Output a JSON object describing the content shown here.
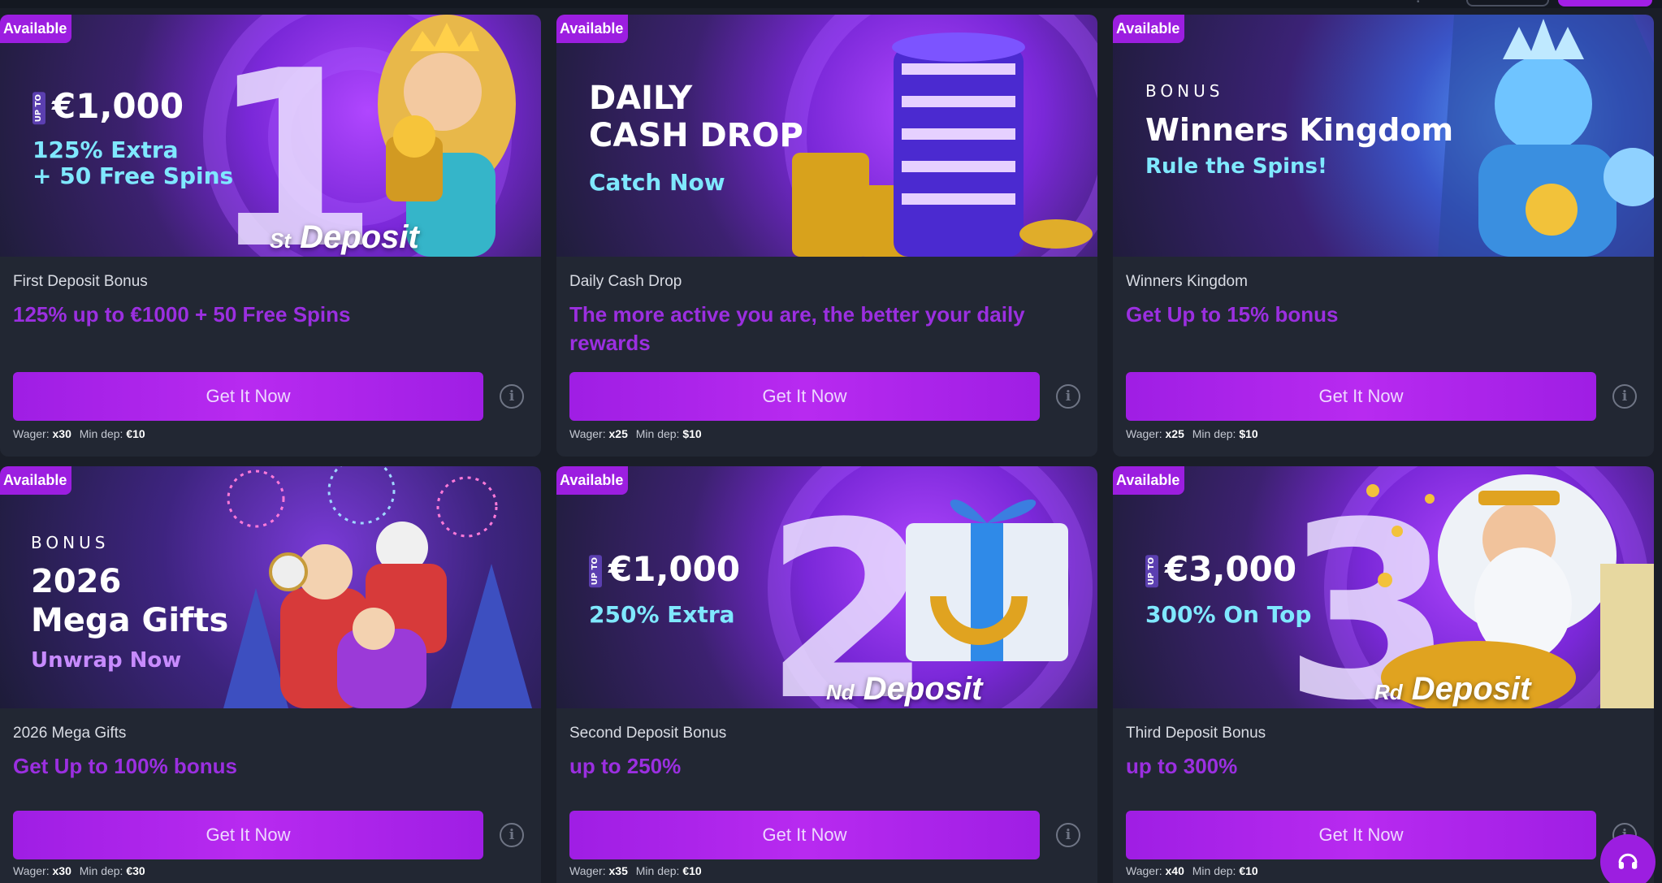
{
  "badge_label": "Available",
  "cta_label": "Get It Now",
  "wager_label": "Wager:",
  "mindep_label": "Min dep:",
  "cards": [
    {
      "title": "First Deposit Bonus",
      "subtitle": "125% up to €1000 + 50 Free Spins",
      "wager": "x30",
      "min_dep": "€10",
      "banner": {
        "upto": "UP TO",
        "amount": "€1,000",
        "line1": "125% Extra",
        "line2": "+ 50 Free Spins",
        "big_num": "1",
        "suffix": "St",
        "deposit_word": "Deposit"
      }
    },
    {
      "title": "Daily Cash Drop",
      "subtitle": "The more active you are, the better your daily rewards",
      "wager": "x25",
      "min_dep": "$10",
      "banner": {
        "line1": "DAILY",
        "line2": "CASH DROP",
        "accent": "Catch Now"
      }
    },
    {
      "title": "Winners Kingdom",
      "subtitle": "Get Up to 15% bonus",
      "wager": "x25",
      "min_dep": "$10",
      "banner": {
        "bonus": "BONUS",
        "headline": "Winners Kingdom",
        "accent": "Rule the Spins!"
      }
    },
    {
      "title": "2026 Mega Gifts",
      "subtitle": "Get Up to 100% bonus",
      "wager": "x30",
      "min_dep": "€30",
      "banner": {
        "bonus": "BONUS",
        "line1": "2026",
        "line2": "Mega Gifts",
        "accent": "Unwrap Now"
      }
    },
    {
      "title": "Second Deposit Bonus",
      "subtitle": "up to 250%",
      "wager": "x35",
      "min_dep": "€10",
      "banner": {
        "upto": "UP TO",
        "amount": "€1,000",
        "line1": "250% Extra",
        "big_num": "2",
        "suffix": "Nd",
        "deposit_word": "Deposit"
      }
    },
    {
      "title": "Third Deposit Bonus",
      "subtitle": "up to 300%",
      "wager": "x40",
      "min_dep": "€10",
      "banner": {
        "upto": "UP TO",
        "amount": "€3,000",
        "line1": "300% On Top",
        "big_num": "3",
        "suffix": "Rd",
        "deposit_word": "Deposit"
      }
    }
  ],
  "colors": {
    "background": "#1a1e28",
    "card": "#222733",
    "accent_purple": "#9c1ee0",
    "subtitle_purple": "#9b2fe0",
    "banner_cyan": "#7fe8ff"
  },
  "icons": {
    "info": "info-circle-icon",
    "support": "headset-icon"
  }
}
